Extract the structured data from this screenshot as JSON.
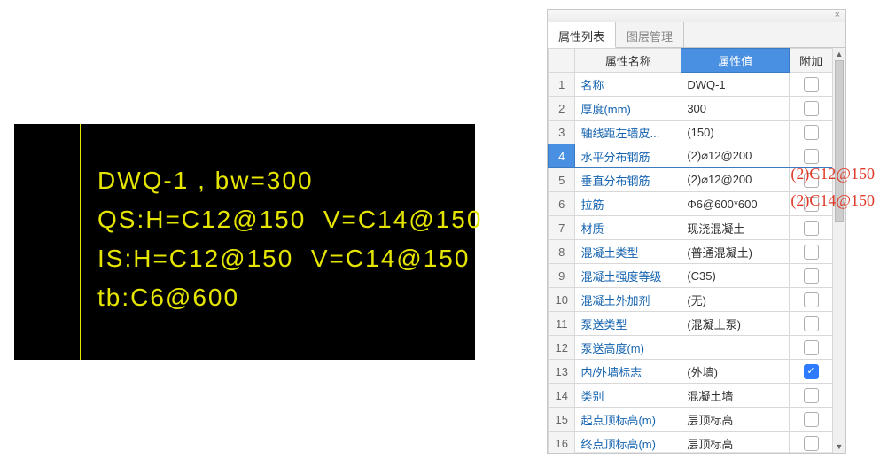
{
  "cad": {
    "line1": "DWQ-1 , bw=300",
    "line2": "QS:H=C12@150  V=C14@150",
    "line3": "IS:H=C12@150  V=C14@150",
    "line4": "tb:C6@600"
  },
  "overlay": {
    "line1": "(2)C12@150",
    "line2": "(2)C14@150"
  },
  "panel": {
    "close": "×",
    "tabs": {
      "attr": "属性列表",
      "layer": "图层管理"
    },
    "headers": {
      "name": "属性名称",
      "value": "属性值",
      "extra": "附加"
    },
    "rows": [
      {
        "n": "1",
        "name": "名称",
        "value": "DWQ-1",
        "chk": false,
        "sel": false
      },
      {
        "n": "2",
        "name": "厚度(mm)",
        "value": "300",
        "chk": false,
        "sel": false
      },
      {
        "n": "3",
        "name": "轴线距左墙皮...",
        "value": "(150)",
        "chk": false,
        "sel": false
      },
      {
        "n": "4",
        "name": "水平分布钢筋",
        "value": "(2)⌀12@200",
        "chk": false,
        "sel": true
      },
      {
        "n": "5",
        "name": "垂直分布钢筋",
        "value": "(2)⌀12@200",
        "chk": false,
        "sel": false
      },
      {
        "n": "6",
        "name": "拉筋",
        "value": "Φ6@600*600",
        "chk": false,
        "sel": false
      },
      {
        "n": "7",
        "name": "材质",
        "value": "现浇混凝土",
        "chk": false,
        "sel": false
      },
      {
        "n": "8",
        "name": "混凝土类型",
        "value": "(普通混凝土)",
        "chk": false,
        "sel": false
      },
      {
        "n": "9",
        "name": "混凝土强度等级",
        "value": "(C35)",
        "chk": false,
        "sel": false
      },
      {
        "n": "10",
        "name": "混凝土外加剂",
        "value": "(无)",
        "chk": false,
        "sel": false
      },
      {
        "n": "11",
        "name": "泵送类型",
        "value": "(混凝土泵)",
        "chk": false,
        "sel": false
      },
      {
        "n": "12",
        "name": "泵送高度(m)",
        "value": "",
        "chk": false,
        "sel": false
      },
      {
        "n": "13",
        "name": "内/外墙标志",
        "value": "(外墙)",
        "chk": true,
        "sel": false
      },
      {
        "n": "14",
        "name": "类别",
        "value": "混凝土墙",
        "chk": false,
        "sel": false
      },
      {
        "n": "15",
        "name": "起点顶标高(m)",
        "value": "层顶标高",
        "chk": false,
        "sel": false
      },
      {
        "n": "16",
        "name": "终点顶标高(m)",
        "value": "层顶标高",
        "chk": false,
        "sel": false
      }
    ]
  }
}
